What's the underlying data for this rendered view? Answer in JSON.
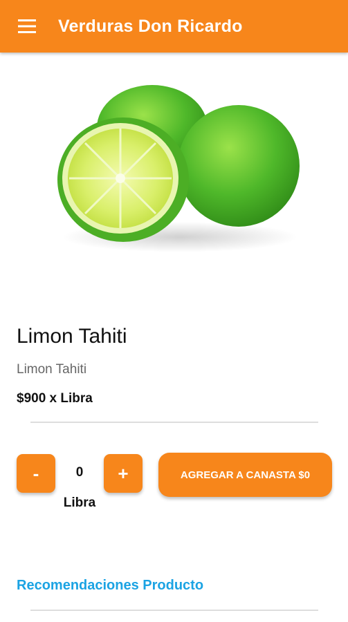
{
  "app_bar": {
    "title": "Verduras Don Ricardo",
    "color": "#f7861b",
    "menu_icon": "hamburger-menu-icon"
  },
  "product": {
    "image": "lime-photo",
    "name": "Limon Tahiti",
    "description": "Limon Tahiti",
    "price": "$900 x Libra"
  },
  "quantity": {
    "decrement_label": "-",
    "value": "0",
    "increment_label": "+",
    "unit": "Libra"
  },
  "cart": {
    "add_label": "AGREGAR A CANASTA $0"
  },
  "recommendations": {
    "label": "Recomendaciones Producto",
    "color": "#1ba3e3"
  }
}
